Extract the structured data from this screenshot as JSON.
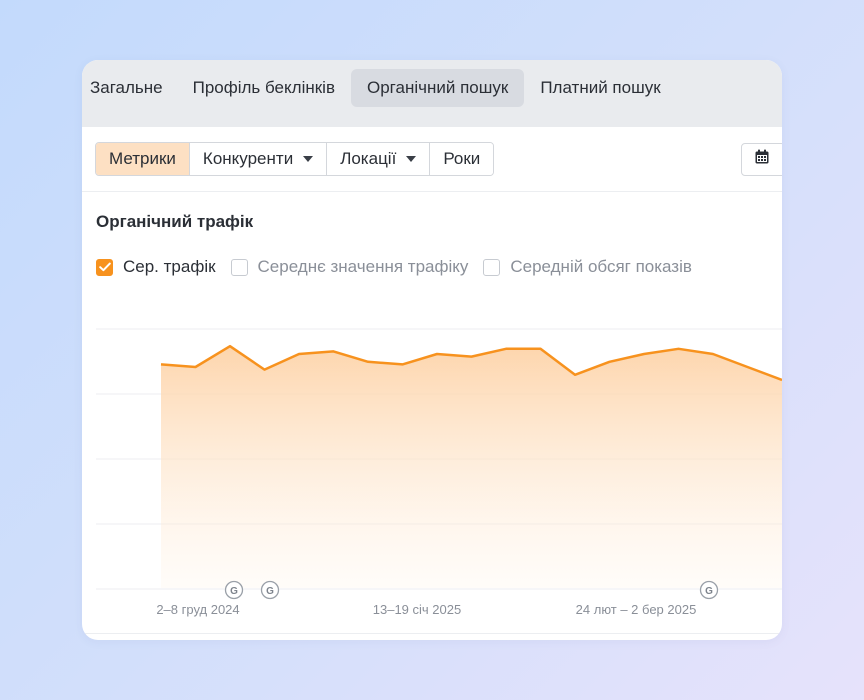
{
  "tabs": [
    {
      "label": "Загальне",
      "active": false
    },
    {
      "label": "Профіль беклінків",
      "active": false
    },
    {
      "label": "Органічний пошук",
      "active": true
    },
    {
      "label": "Платний пошук",
      "active": false
    }
  ],
  "toolbar": {
    "metrics_label": "Метрики",
    "competitors_label": "Конкуренти",
    "locations_label": "Локації",
    "years_label": "Роки",
    "calendar_icon": "calendar-icon"
  },
  "section": {
    "title": "Органічний трафік"
  },
  "legend": [
    {
      "label": "Сер. трафік",
      "checked": true
    },
    {
      "label": "Середнє значення трафіку",
      "checked": false
    },
    {
      "label": "Середній обсяг показів",
      "checked": false
    }
  ],
  "colors": {
    "accent": "#f7921e",
    "area_top": "#fdd3a8",
    "active_segment": "#fde0c3"
  },
  "chart_data": {
    "type": "area",
    "series": [
      {
        "values": [
          0.86,
          0.85,
          0.93,
          0.84,
          0.9,
          0.91,
          0.87,
          0.86,
          0.9,
          0.89,
          0.92,
          0.92,
          0.82,
          0.87,
          0.9,
          0.92,
          0.9,
          0.85,
          0.8
        ]
      }
    ],
    "x_tick_labels": [
      "2–8 груд 2024",
      "13–19 січ 2025",
      "24 лют – 2 бер 2025"
    ],
    "annotations": [
      {
        "label": "G",
        "x_index": 2
      },
      {
        "label": "G",
        "x_index": 3
      },
      {
        "label": "G",
        "x_index": 15
      }
    ],
    "grid": true,
    "ylim": [
      0,
      1
    ]
  }
}
